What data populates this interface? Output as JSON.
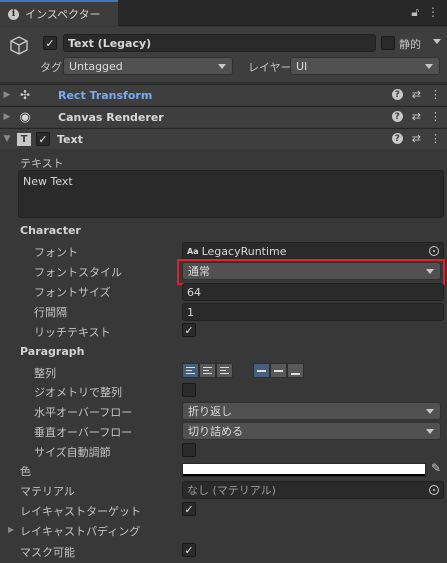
{
  "tab": {
    "title": "インスペクター"
  },
  "header": {
    "object_name": "Text (Legacy)",
    "static_label": "静的",
    "tag_label": "タグ",
    "tag_value": "Untagged",
    "layer_label": "レイヤー",
    "layer_value": "UI"
  },
  "components": {
    "rect_transform": "Rect Transform",
    "canvas_renderer": "Canvas Renderer",
    "text": "Text"
  },
  "text_component": {
    "text_label": "テキスト",
    "text_value": "New Text",
    "character_header": "Character",
    "font_label": "フォント",
    "font_value": "LegacyRuntime",
    "font_prefix": "Aa",
    "font_style_label": "フォントスタイル",
    "font_style_value": "通常",
    "font_size_label": "フォントサイズ",
    "font_size_value": "64",
    "line_spacing_label": "行間隔",
    "line_spacing_value": "1",
    "rich_text_label": "リッチテキスト",
    "paragraph_header": "Paragraph",
    "alignment_label": "整列",
    "align_geometry_label": "ジオメトリで整列",
    "h_overflow_label": "水平オーバーフロー",
    "h_overflow_value": "折り返し",
    "v_overflow_label": "垂直オーバーフロー",
    "v_overflow_value": "切り詰める",
    "best_fit_label": "サイズ自動調節",
    "color_label": "色",
    "material_label": "マテリアル",
    "material_value": "なし (マテリアル)",
    "raycast_target_label": "レイキャストターゲット",
    "raycast_padding_label": "レイキャストパディング",
    "maskable_label": "マスク可能"
  },
  "colors": {
    "highlight_border": "#e0212b",
    "link_blue": "#7aaaf0",
    "text_color_swatch": "#ffffff"
  }
}
